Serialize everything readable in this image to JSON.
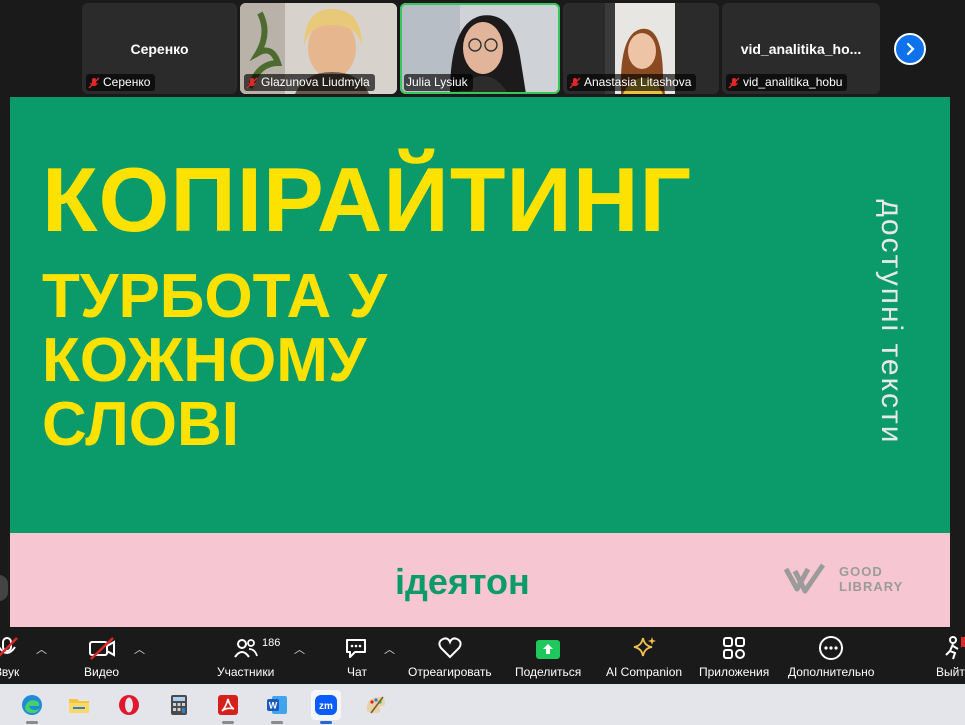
{
  "participants": [
    {
      "name": "Серенко",
      "center_name": "Серенко",
      "video": false
    },
    {
      "name": "Glazunova Liudmyla",
      "video": true
    },
    {
      "name": "Julia Lysiuk",
      "video": true,
      "active_speaker": true
    },
    {
      "name": "Anastasia Litashova",
      "video": true
    },
    {
      "name": "vid_analitika_hobu",
      "center_name": "vid_analitika_ho...",
      "video": false
    }
  ],
  "slide": {
    "title": "КОПІРАЙТИНГ",
    "subtitle_lines": [
      "ТУРБОТА У",
      "КОЖНОМУ",
      "СЛОВІ"
    ],
    "side_text": "доступні тексти",
    "footer_text": "ідеятон",
    "logo_line1": "GOOD",
    "logo_line2": "LIBRARY",
    "colors": {
      "green": "#0b9b6b",
      "yellow": "#fde200",
      "pink": "#f6c7d2"
    }
  },
  "toolbar": {
    "audio": "Звук",
    "video": "Видео",
    "participants": "Участники",
    "participants_count": "186",
    "chat": "Чат",
    "react": "Отреагировать",
    "share": "Поделиться",
    "ai": "AI Companion",
    "apps": "Приложения",
    "more": "Дополнительно",
    "leave": "Выйти"
  },
  "taskbar": [
    "edge-icon",
    "file-explorer-icon",
    "opera-icon",
    "calculator-icon",
    "acrobat-icon",
    "word-icon",
    "zoom-icon",
    "paint-icon"
  ]
}
